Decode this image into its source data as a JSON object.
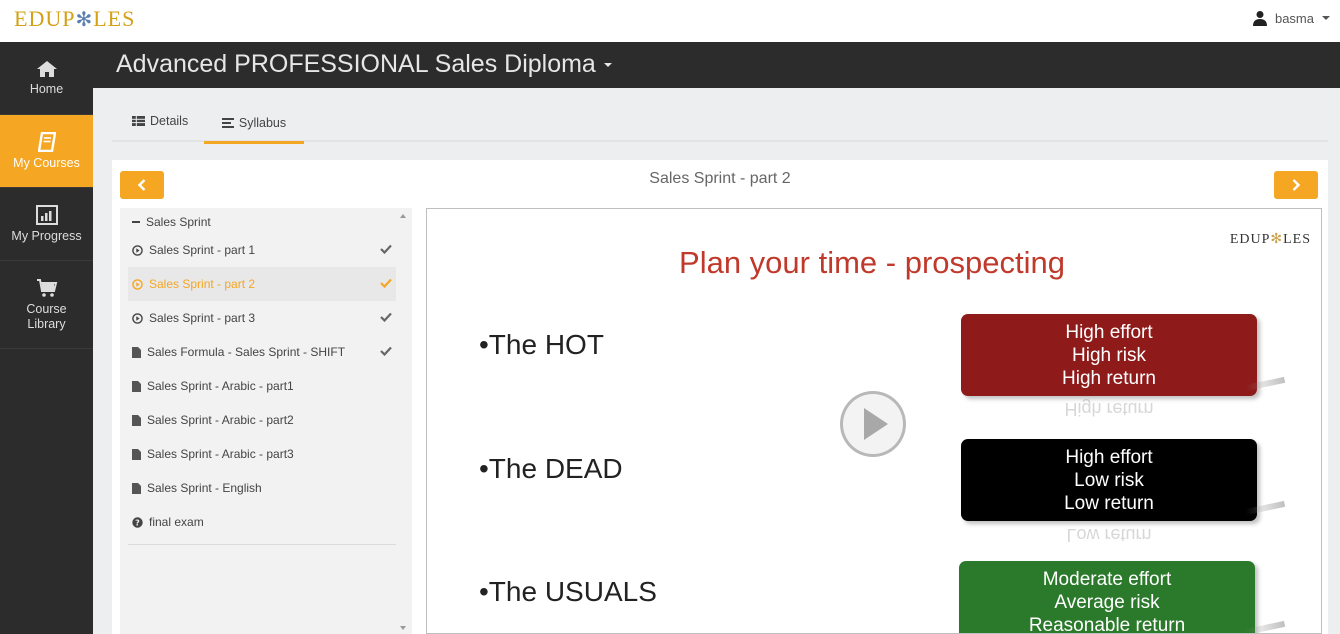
{
  "brand": {
    "logo_left": "EDUP",
    "logo_star": "✻",
    "logo_right": "LES"
  },
  "user": {
    "name": "basma"
  },
  "sidebar": {
    "items": [
      {
        "label": "Home",
        "icon": "home-icon"
      },
      {
        "label": "My Courses",
        "icon": "book-icon",
        "active": true
      },
      {
        "label": "My Progress",
        "icon": "chart-icon"
      },
      {
        "label": "Course Library",
        "icon": "cart-icon"
      }
    ]
  },
  "course": {
    "title": "Advanced PROFESSIONAL Sales Diploma"
  },
  "tabs": [
    {
      "label": "Details",
      "icon": "table-icon"
    },
    {
      "label": "Syllabus",
      "icon": "list-icon",
      "active": true
    }
  ],
  "lesson": {
    "title": "Sales Sprint - part 2"
  },
  "syllabus": {
    "section": "Sales Sprint",
    "items": [
      {
        "label": "Sales Sprint - part 1",
        "icon": "play-circle-icon",
        "done": true
      },
      {
        "label": "Sales Sprint - part 2",
        "icon": "play-circle-icon",
        "done": true,
        "active": true
      },
      {
        "label": "Sales Sprint - part 3",
        "icon": "play-circle-icon",
        "done": true
      },
      {
        "label": "Sales Formula - Sales Sprint - SHIFT",
        "icon": "file-icon",
        "done": true
      },
      {
        "label": "Sales Sprint - Arabic - part1",
        "icon": "file-icon",
        "done": false
      },
      {
        "label": "Sales Sprint - Arabic - part2",
        "icon": "file-icon",
        "done": false
      },
      {
        "label": "Sales Sprint - Arabic - part3",
        "icon": "file-icon",
        "done": false
      },
      {
        "label": "Sales Sprint - English",
        "icon": "file-icon",
        "done": false
      },
      {
        "label": "final exam",
        "icon": "question-circle-icon",
        "done": false
      }
    ]
  },
  "slide": {
    "logo_left": "EDUP",
    "logo_star": "✻",
    "logo_right": "LES",
    "title": "Plan your time - prospecting",
    "bullets": [
      "•The HOT",
      "•The DEAD",
      "•The USUALS"
    ],
    "boxes": [
      {
        "lines": [
          "High effort",
          "High risk",
          "High return"
        ],
        "reflection": "High return",
        "color": "#8e1a1a"
      },
      {
        "lines": [
          "High effort",
          "Low risk",
          "Low return"
        ],
        "reflection": "Low return",
        "color": "#000000"
      },
      {
        "lines": [
          "Moderate effort",
          "Average risk",
          "Reasonable return"
        ],
        "color": "#2b7a2b"
      }
    ]
  },
  "colors": {
    "accent": "#f5a623",
    "sidebar_bg": "#2c2c2c"
  }
}
